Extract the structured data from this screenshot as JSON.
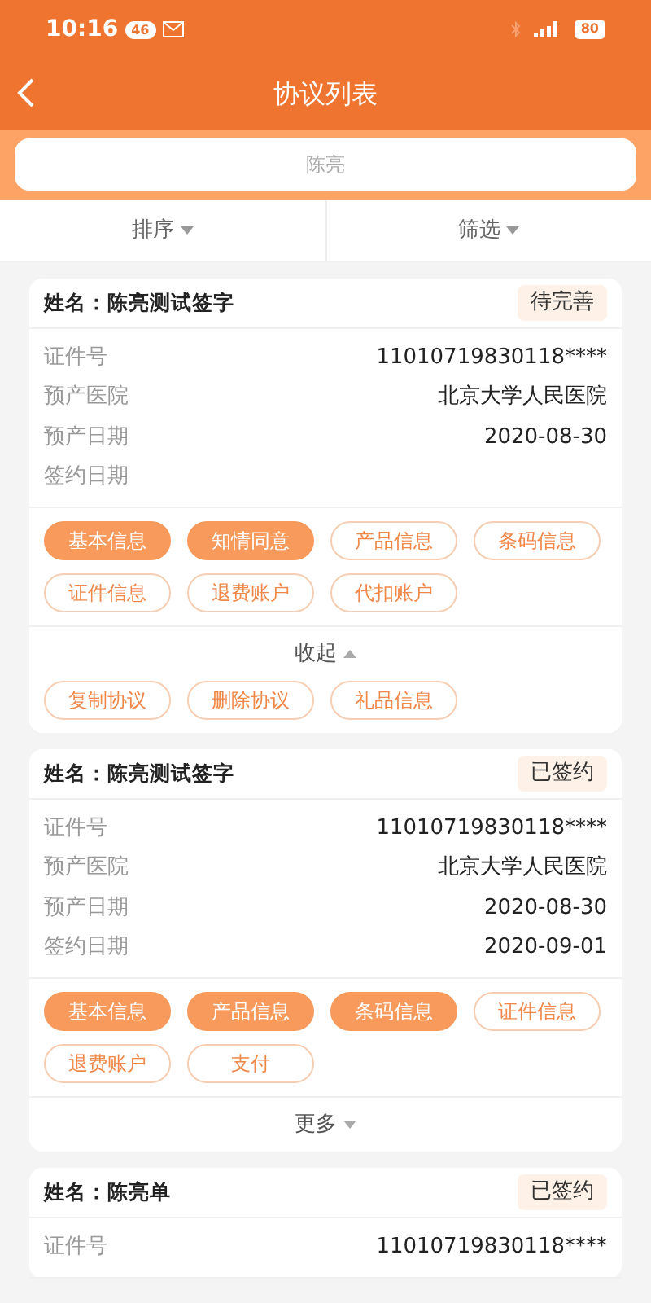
{
  "status_bar": {
    "time": "10:16",
    "network_badge": "46",
    "battery": "80"
  },
  "header": {
    "title": "协议列表"
  },
  "search": {
    "placeholder": "陈亮"
  },
  "filters": [
    {
      "label": "排序"
    },
    {
      "label": "筛选"
    }
  ],
  "agreements": [
    {
      "name": "姓名：陈亮测试签字",
      "status": "待完善",
      "fields": [
        {
          "label": "证件号",
          "value": "11010719830118****"
        },
        {
          "label": "预产医院",
          "value": "北京大学人民医院"
        },
        {
          "label": "预产日期",
          "value": "2020-08-30"
        },
        {
          "label": "签约日期"
        }
      ],
      "tags": [
        {
          "label": "基本信息",
          "completed": true
        },
        {
          "label": "知情同意",
          "completed": true
        },
        {
          "label": "产品信息",
          "completed": false
        },
        {
          "label": "条码信息",
          "completed": false
        },
        {
          "label": "证件信息",
          "completed": false
        },
        {
          "label": "退费账户",
          "completed": false
        },
        {
          "label": "代扣账户",
          "completed": false
        }
      ],
      "toggle": {
        "label": "收起",
        "expanded": true
      },
      "actions": [
        {
          "label": "复制协议"
        },
        {
          "label": "删除协议"
        },
        {
          "label": "礼品信息"
        }
      ]
    },
    {
      "name": "姓名：陈亮测试签字",
      "status": "已签约",
      "fields": [
        {
          "label": "证件号",
          "value": "11010719830118****"
        },
        {
          "label": "预产医院",
          "value": "北京大学人民医院"
        },
        {
          "label": "预产日期",
          "value": "2020-08-30"
        },
        {
          "label": "签约日期",
          "value": "2020-09-01"
        }
      ],
      "tags": [
        {
          "label": "基本信息",
          "completed": true
        },
        {
          "label": "产品信息",
          "completed": true
        },
        {
          "label": "条码信息",
          "completed": true
        },
        {
          "label": "证件信息",
          "completed": false
        },
        {
          "label": "退费账户",
          "completed": false
        },
        {
          "label": "支付",
          "completed": false
        }
      ],
      "toggle": {
        "label": "更多",
        "expanded": false
      }
    },
    {
      "name": "姓名：陈亮单",
      "status": "已签约",
      "fields": [
        {
          "label": "证件号",
          "value": "11010719830118****"
        }
      ]
    }
  ]
}
